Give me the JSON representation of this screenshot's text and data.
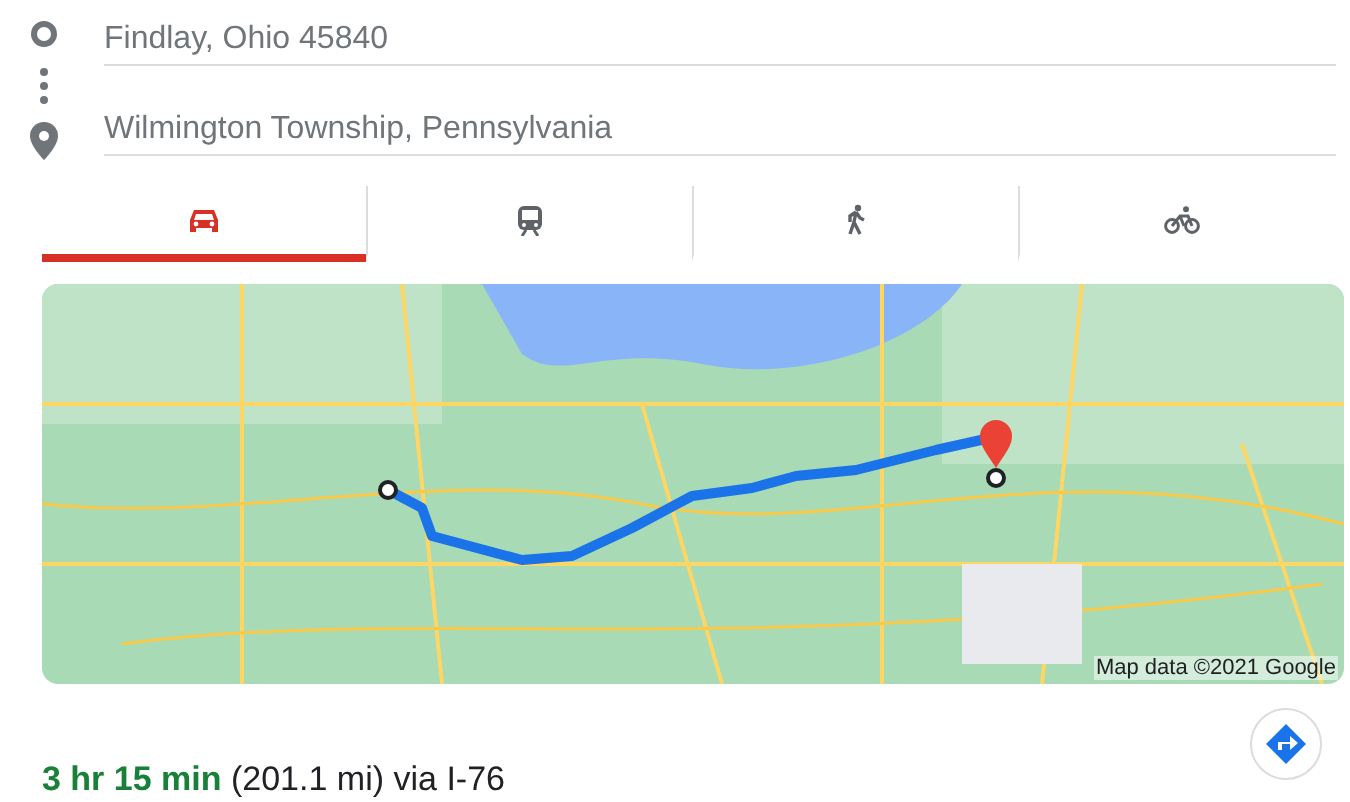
{
  "origin": {
    "placeholder": "Findlay, Ohio 45840"
  },
  "destination": {
    "placeholder": "Wilmington Township, Pennsylvania"
  },
  "tabs": [
    {
      "kind": "car",
      "selected": true
    },
    {
      "kind": "transit",
      "selected": false
    },
    {
      "kind": "walk",
      "selected": false
    },
    {
      "kind": "bike",
      "selected": false
    }
  ],
  "map": {
    "kind": "picture",
    "attribution": "Map data ©2021 Google"
  },
  "summary": "**3 hr 15 min** (201.1 mi) via I-76"
}
